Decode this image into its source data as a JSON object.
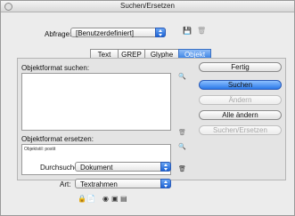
{
  "window": {
    "title": "Suchen/Ersetzen"
  },
  "query": {
    "label": "Abfrage:",
    "value": "[Benutzerdefiniert]"
  },
  "tabs": [
    {
      "label": "Text",
      "active": false
    },
    {
      "label": "GREP",
      "active": false
    },
    {
      "label": "Glyphe",
      "active": false
    },
    {
      "label": "Objekt",
      "active": true
    }
  ],
  "find": {
    "label": "Objektformat suchen:",
    "value": ""
  },
  "replace": {
    "label": "Objektformat ersetzen:",
    "value": "Objektstil: postit"
  },
  "search_in": {
    "label": "Durchsuchen:",
    "value": "Dokument"
  },
  "type": {
    "label": "Art:",
    "value": "Textrahmen"
  },
  "buttons": {
    "done": "Fertig",
    "find": "Suchen",
    "change": "Ändern",
    "change_all": "Alle ändern",
    "change_find": "Suchen/Ersetzen"
  }
}
